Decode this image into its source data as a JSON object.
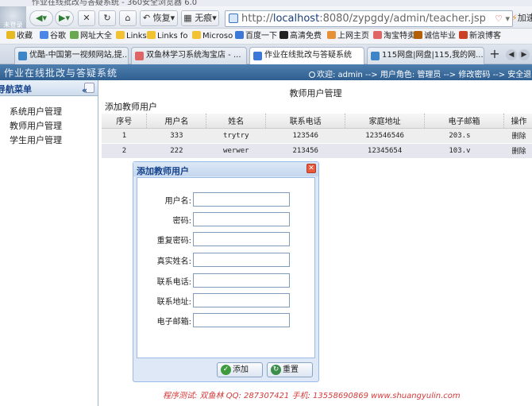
{
  "browser": {
    "window_title": "作业在线批改与答疑系统 - 360安全浏览器 6.0",
    "avatar_label": "未登录",
    "nav": {
      "recover_label": "恢复",
      "no_trace_label": "无痕"
    },
    "address": {
      "scheme": "http://",
      "host": "localhost",
      "path": ":8080/zypgdy/admin/teacher.jsp"
    },
    "accelerate_label": "加速",
    "favorites": [
      {
        "label": "收藏",
        "color": "#e8b923"
      },
      {
        "label": "谷歌",
        "color": "#4a86e8"
      },
      {
        "label": "网址大全",
        "color": "#6aa84f"
      },
      {
        "label": "Links",
        "color": "#f1c232"
      },
      {
        "label": "Links fo",
        "color": "#f1c232"
      },
      {
        "label": "Microso",
        "color": "#f1c232"
      },
      {
        "label": "百度一下",
        "color": "#3c78d8"
      },
      {
        "label": "高清免费",
        "color": "#222222"
      },
      {
        "label": "上网主页",
        "color": "#e69138"
      },
      {
        "label": "淘宝特卖",
        "color": "#e06666"
      },
      {
        "label": "诚信毕业",
        "color": "#b45f06"
      },
      {
        "label": "新浪博客",
        "color": "#cc4125"
      }
    ],
    "tabs": [
      {
        "label": "优酷-中国第一视频网站,提...",
        "color": "#3d85c6"
      },
      {
        "label": "双鱼林学习系统淘宝店 - ...",
        "color": "#e06666"
      },
      {
        "label": "作业在线批改与答疑系统",
        "color": "#3c78d8"
      },
      {
        "label": "115网盘|网盘|115,我的网...",
        "color": "#3d85c6"
      }
    ]
  },
  "app": {
    "title": "作业在线批改与答疑系统",
    "status": "欢迎: admin --> 用户角色: 管理员 --> 修改密码 --> 安全退出",
    "sidebar": {
      "header": "导航菜单",
      "collapse_symbol": "«",
      "items": [
        {
          "label": "系统用户管理"
        },
        {
          "label": "教师用户管理"
        },
        {
          "label": "学生用户管理"
        }
      ]
    },
    "main": {
      "section_title": "教师用户管理",
      "add_link": "添加教师用户",
      "table": {
        "columns": [
          "序号",
          "用户名",
          "姓名",
          "联系电话",
          "家庭地址",
          "电子邮箱",
          "操作"
        ],
        "rows": [
          {
            "index": "1",
            "username": "333",
            "name": "trytry",
            "phone": "123546",
            "address": "123546546",
            "email": "203.s",
            "op": "删除"
          },
          {
            "index": "2",
            "username": "222",
            "name": "werwer",
            "phone": "213456",
            "address": "12345654",
            "email": "103.v",
            "op": "删除"
          }
        ]
      }
    },
    "dialog": {
      "title": "添加教师用户",
      "fields": [
        {
          "label": "用户名:",
          "value": ""
        },
        {
          "label": "密码:",
          "value": ""
        },
        {
          "label": "重复密码:",
          "value": ""
        },
        {
          "label": "真实姓名:",
          "value": ""
        },
        {
          "label": "联系电话:",
          "value": ""
        },
        {
          "label": "联系地址:",
          "value": ""
        },
        {
          "label": "电子邮箱:",
          "value": ""
        }
      ],
      "add_button": "添加",
      "reset_button": "重置"
    },
    "footer": "程序测试: 双鱼林   QQ: 287307421   手机: 13558690869   www.shuangyulin.com"
  }
}
